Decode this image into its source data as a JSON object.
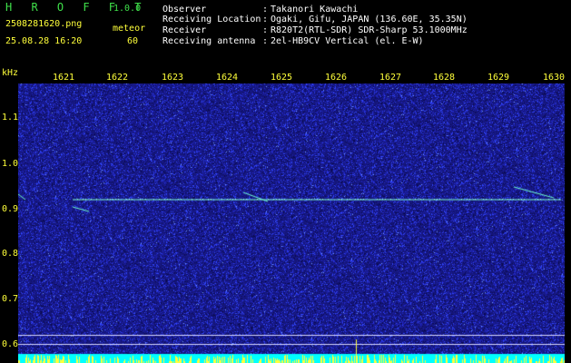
{
  "header": {
    "app_title": "H R O F F T",
    "app_version": "1.0.0",
    "file_name": "2508281620.png",
    "meteor_label": "meteor",
    "timestamp": "25.08.28 16:20",
    "meteor_count": "60"
  },
  "info": [
    {
      "label": "Observer",
      "value": "Takanori Kawachi"
    },
    {
      "label": "Receiving Location",
      "value": "Ogaki, Gifu, JAPAN (136.60E, 35.35N)"
    },
    {
      "label": "Receiver",
      "value": "R820T2(RTL-SDR) SDR-Sharp 53.1000MHz"
    },
    {
      "label": "Receiving antenna",
      "value": "2el-HB9CV Vertical (el. E-W)"
    }
  ],
  "axis": {
    "y_unit": "kHz",
    "y_ticks": [
      "1.1",
      "1.0",
      "0.9",
      "0.8",
      "0.7",
      "0.6"
    ],
    "x_ticks": [
      "1621",
      "1622",
      "1623",
      "1624",
      "1625",
      "1626",
      "1627",
      "1628",
      "1629",
      "1630"
    ]
  },
  "colors": {
    "background": "#000000",
    "spectrogram_base": "#15167a",
    "noise_bright": "#3a50ff",
    "carrier_line": "#7fffd0",
    "label_green": "#3fe04a",
    "label_yellow": "#ffff3a",
    "strip_cyan": "#00ffff"
  }
}
